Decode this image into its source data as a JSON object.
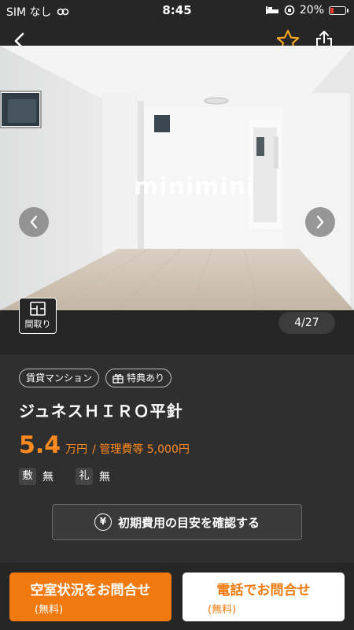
{
  "status_bar": {
    "carrier": "SIM なし",
    "time": "8:45",
    "battery": "20%",
    "battery_level": 0.2
  },
  "nav": {
    "back_icon": "chevron-left-icon",
    "favorite_icon": "star-outline-icon",
    "share_icon": "share-icon",
    "accent_color": "#f5a623"
  },
  "gallery": {
    "watermark": "minimini",
    "floorplan_label": "間取り",
    "counter": "4/27"
  },
  "property": {
    "tags": [
      "賃貸マンション",
      "特典あり"
    ],
    "name": "ジュネスＨＩＲＯ平針",
    "price": "5.4",
    "price_unit": "万円",
    "management_fee": "/ 管理費等 5,000円",
    "deposit_key": "敷",
    "deposit_value": "無",
    "key_money_key": "礼",
    "key_money_value": "無",
    "cost_button": "初期費用の目安を確認する"
  },
  "actions": {
    "vacancy_main": "空室状況をお問合せ",
    "vacancy_sub": "(無料)",
    "phone_main": "電話でお問合せ",
    "phone_sub": "(無料)",
    "brand_color": "#f07a10"
  }
}
